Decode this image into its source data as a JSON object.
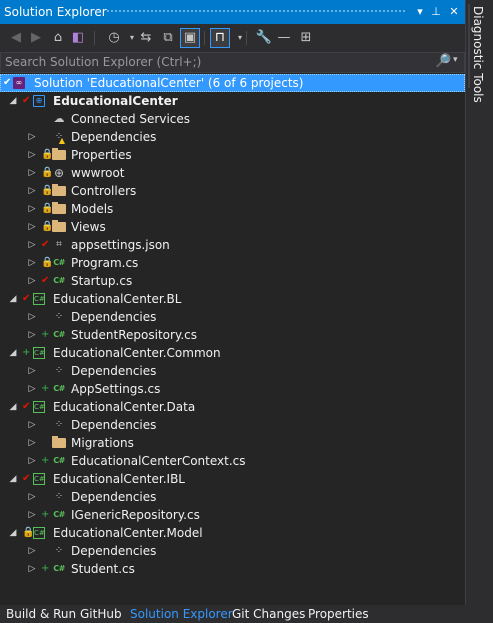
{
  "window": {
    "title": "Solution Explorer",
    "title_icons": {
      "dropdown": "▾",
      "pin": "⊥",
      "close": "✕"
    }
  },
  "toolbar": {
    "icons": [
      "back-icon",
      "forward-icon",
      "home-icon",
      "vs-icon",
      "history-icon",
      "sync-icon",
      "collapse-all-icon",
      "show-all-files-icon",
      "preview-icon",
      "properties-icon",
      "minus-icon",
      "class-view-icon"
    ]
  },
  "search": {
    "placeholder": "Search Solution Explorer (Ctrl+;)",
    "icon": "🔎",
    "dropdown": "▾"
  },
  "tree": [
    {
      "label": "Solution 'EducationalCenter' (6 of 6 projects)",
      "selected": true
    },
    {
      "label": "EducationalCenter"
    },
    {
      "label": "Connected Services"
    },
    {
      "label": "Dependencies"
    },
    {
      "label": "Properties"
    },
    {
      "label": "wwwroot"
    },
    {
      "label": "Controllers"
    },
    {
      "label": "Models"
    },
    {
      "label": "Views"
    },
    {
      "label": "appsettings.json"
    },
    {
      "label": "Program.cs"
    },
    {
      "label": "Startup.cs"
    },
    {
      "label": "EducationalCenter.BL"
    },
    {
      "label": "Dependencies"
    },
    {
      "label": "StudentRepository.cs"
    },
    {
      "label": "EducationalCenter.Common"
    },
    {
      "label": "Dependencies"
    },
    {
      "label": "AppSettings.cs"
    },
    {
      "label": "EducationalCenter.Data"
    },
    {
      "label": "Dependencies"
    },
    {
      "label": "Migrations"
    },
    {
      "label": "EducationalCenterContext.cs"
    },
    {
      "label": "EducationalCenter.IBL"
    },
    {
      "label": "Dependencies"
    },
    {
      "label": "IGenericRepository.cs"
    },
    {
      "label": "EducationalCenter.Model"
    },
    {
      "label": "Dependencies"
    },
    {
      "label": "Student.cs"
    }
  ],
  "sidebar": {
    "tab": "Diagnostic Tools"
  },
  "bottom_tabs": [
    {
      "label": "Build & Run"
    },
    {
      "label": "GitHub"
    },
    {
      "label": "Solution Explorer",
      "active": true
    },
    {
      "label": "Git Changes"
    },
    {
      "label": "Properties"
    }
  ],
  "colors": {
    "accent": "#007acc",
    "selection": "#3399ff",
    "background": "#252526",
    "check": "#e51400",
    "plus": "#3ab34a"
  }
}
